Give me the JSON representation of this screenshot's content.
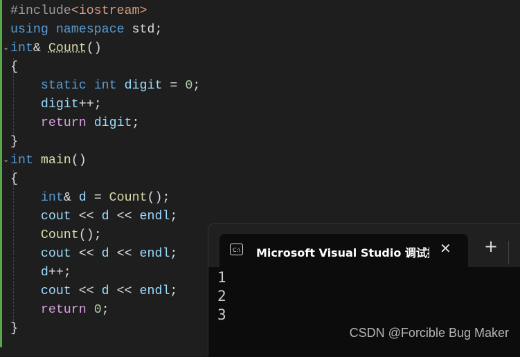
{
  "code": [
    [
      [
        "#include",
        "p"
      ],
      [
        "<iostream>",
        "s"
      ]
    ],
    [
      [
        "using ",
        "k"
      ],
      [
        "namespace ",
        "k"
      ],
      [
        "std;",
        "t"
      ]
    ],
    [
      [
        "int",
        "k"
      ],
      [
        "& ",
        "t"
      ],
      [
        "Count",
        "f ul"
      ],
      [
        "()",
        "t"
      ]
    ],
    [
      [
        "{",
        "t"
      ]
    ],
    [
      [
        "    static ",
        "k"
      ],
      [
        "int ",
        "k"
      ],
      [
        "digit",
        "v"
      ],
      [
        " = ",
        "t"
      ],
      [
        "0",
        "n"
      ],
      [
        ";",
        "t"
      ]
    ],
    [
      [
        "    digit",
        "v"
      ],
      [
        "++;",
        "t"
      ]
    ],
    [
      [
        "    return ",
        "r"
      ],
      [
        "digit",
        "v"
      ],
      [
        ";",
        "t"
      ]
    ],
    [
      [
        "}",
        "t"
      ]
    ],
    [
      [
        "int ",
        "k"
      ],
      [
        "main",
        "f"
      ],
      [
        "()",
        "t"
      ]
    ],
    [
      [
        "{",
        "t"
      ]
    ],
    [
      [
        "    int",
        "k"
      ],
      [
        "& ",
        "t"
      ],
      [
        "d",
        "v"
      ],
      [
        " = ",
        "t"
      ],
      [
        "Count",
        "f"
      ],
      [
        "();",
        "t"
      ]
    ],
    [
      [
        "    cout",
        "v"
      ],
      [
        " << ",
        "t"
      ],
      [
        "d",
        "v"
      ],
      [
        " << ",
        "t"
      ],
      [
        "endl",
        "v"
      ],
      [
        ";",
        "t"
      ]
    ],
    [
      [
        "    Count",
        "f"
      ],
      [
        "();",
        "t"
      ]
    ],
    [
      [
        "    cout",
        "v"
      ],
      [
        " << ",
        "t"
      ],
      [
        "d",
        "v"
      ],
      [
        " << ",
        "t"
      ],
      [
        "endl",
        "v"
      ],
      [
        ";",
        "t"
      ]
    ],
    [
      [
        "    d",
        "v"
      ],
      [
        "++;",
        "t"
      ]
    ],
    [
      [
        "    cout",
        "v"
      ],
      [
        " << ",
        "t"
      ],
      [
        "d",
        "v"
      ],
      [
        " << ",
        "t"
      ],
      [
        "endl",
        "v"
      ],
      [
        ";",
        "t"
      ]
    ],
    [
      [
        "    return ",
        "r"
      ],
      [
        "0",
        "n"
      ],
      [
        ";",
        "t"
      ]
    ],
    [
      [
        "}",
        "t"
      ]
    ]
  ],
  "terminal": {
    "icon": "terminal-icon",
    "icon_text": "C:\\",
    "tab_title": "Microsoft Visual Studio 调试控制台",
    "close": "✕",
    "new_tab": "+",
    "output": [
      "1",
      "2",
      "3"
    ]
  },
  "watermark": "CSDN @Forcible Bug Maker"
}
